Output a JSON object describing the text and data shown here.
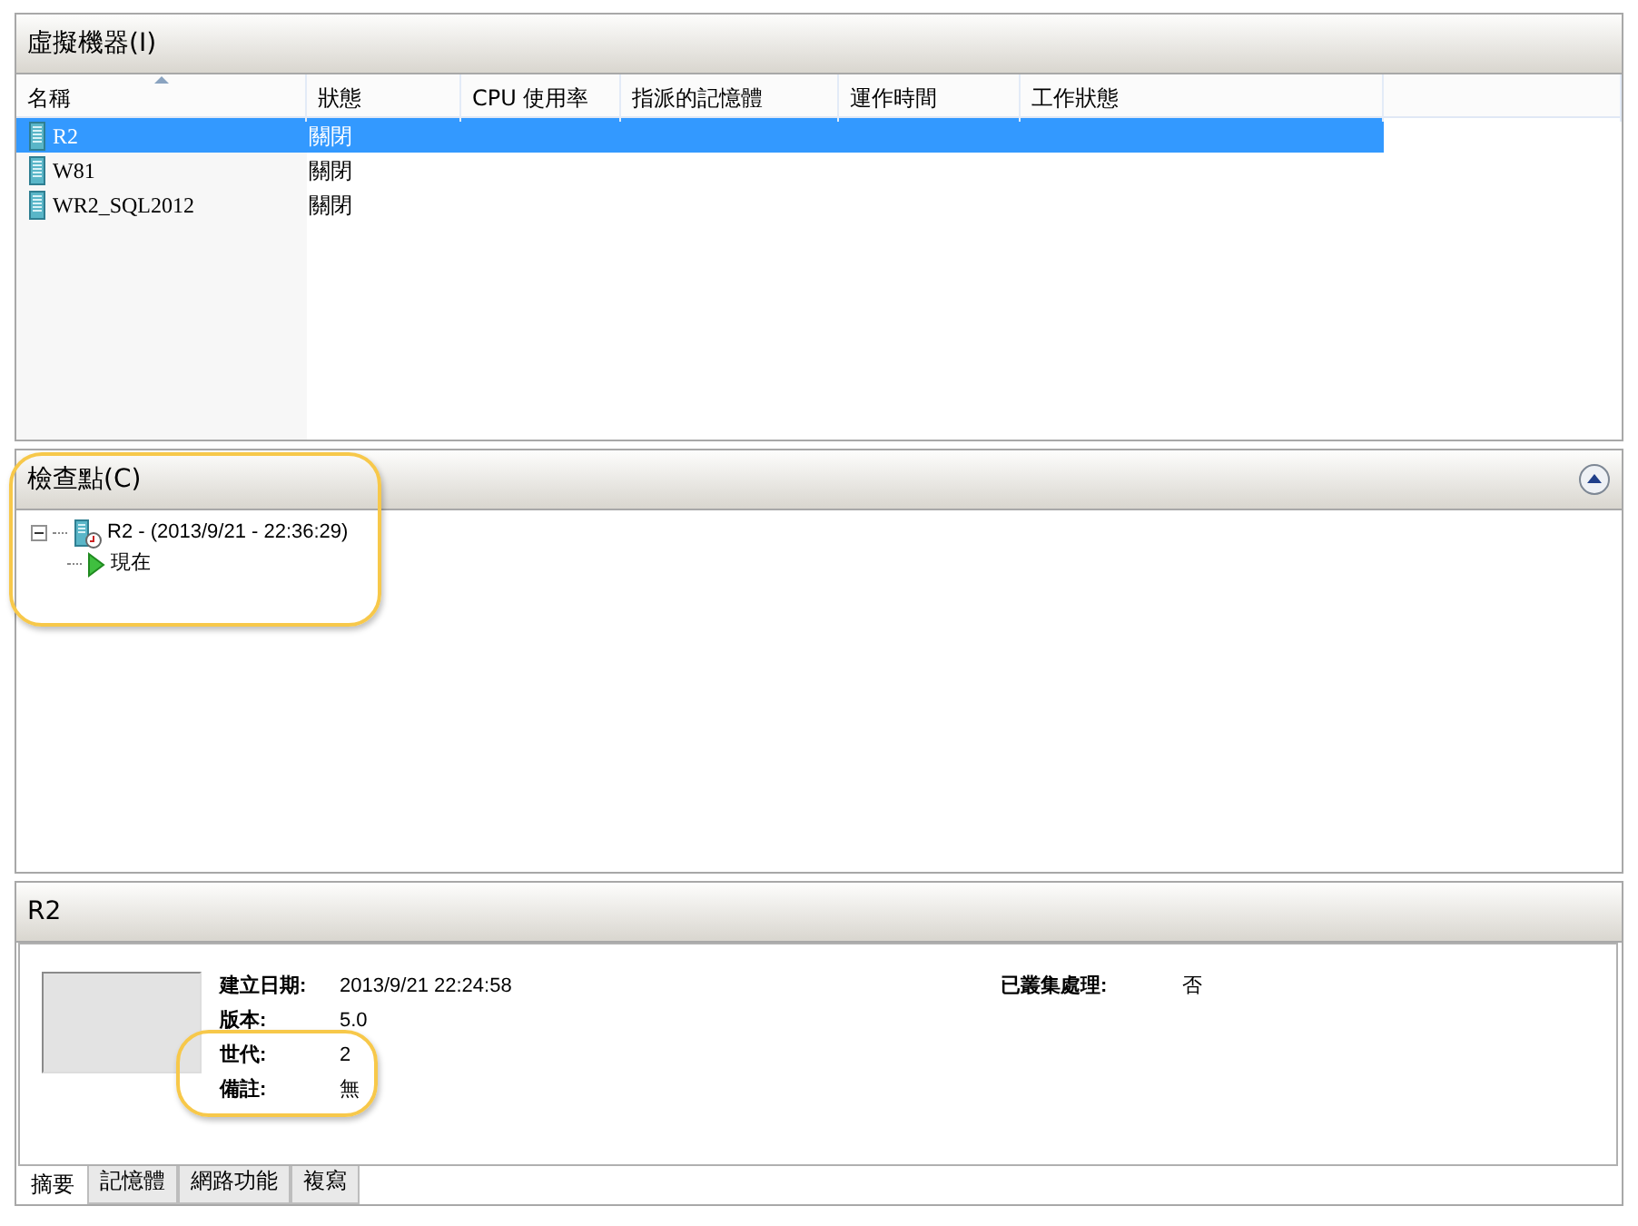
{
  "vm_panel": {
    "title": "虛擬機器(I)",
    "columns": [
      {
        "label": "名稱",
        "sorted": true
      },
      {
        "label": "狀態",
        "sorted": false
      },
      {
        "label": "CPU 使用率",
        "sorted": false
      },
      {
        "label": "指派的記憶體",
        "sorted": false
      },
      {
        "label": "運作時間",
        "sorted": false
      },
      {
        "label": "工作狀態",
        "sorted": false
      }
    ],
    "rows": [
      {
        "name": "R2",
        "status": "關閉",
        "selected": true
      },
      {
        "name": "W81",
        "status": "關閉",
        "selected": false
      },
      {
        "name": "WR2_SQL2012",
        "status": "關閉",
        "selected": false
      }
    ]
  },
  "checkpoint_panel": {
    "title": "檢查點(C)",
    "tree": [
      {
        "label": "R2 - (2013/9/21 - 22:36:29)",
        "kind": "checkpoint",
        "expanded": true,
        "children": [
          {
            "label": "現在",
            "kind": "now"
          }
        ]
      }
    ]
  },
  "detail_panel": {
    "title": "R2",
    "fields": [
      {
        "label": "建立日期:",
        "value": "2013/9/21 22:24:58"
      },
      {
        "label": "版本:",
        "value": "5.0"
      },
      {
        "label": "世代:",
        "value": "2"
      },
      {
        "label": "備註:",
        "value": "無"
      }
    ],
    "side_fields": [
      {
        "label": "已叢集處理:",
        "value": "否"
      }
    ],
    "tabs": [
      {
        "label": "摘要",
        "selected": true
      },
      {
        "label": "記憶體",
        "selected": false
      },
      {
        "label": "網路功能",
        "selected": false
      },
      {
        "label": "複寫",
        "selected": false
      }
    ]
  }
}
